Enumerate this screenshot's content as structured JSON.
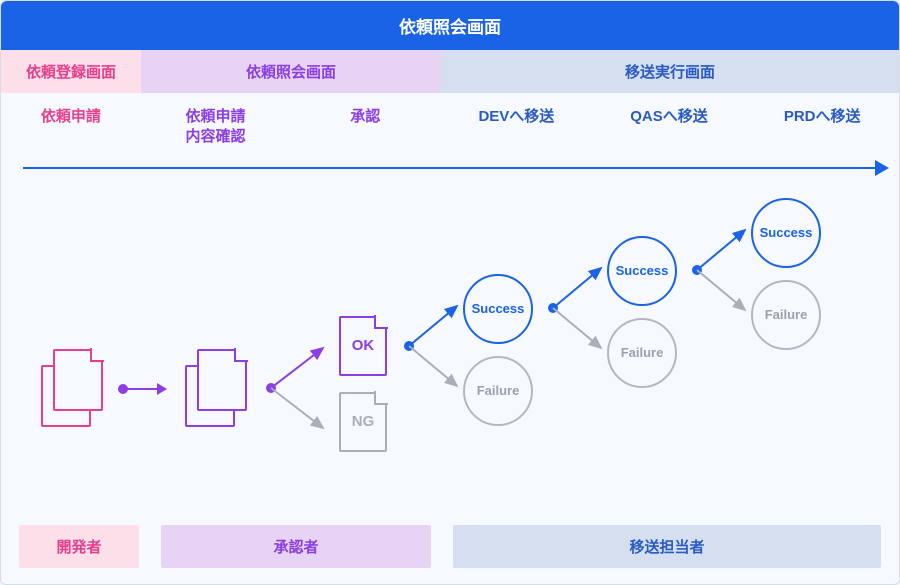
{
  "title": "依頼照会画面",
  "screens": {
    "register": "依頼登録画面",
    "inquiry": "依頼照会画面",
    "transfer": "移送実行画面"
  },
  "steps": {
    "s1": "依頼申請",
    "s2": "依頼申請\n内容確認",
    "s3": "承認",
    "s4": "DEVへ移送",
    "s5": "QASへ移送",
    "s6": "PRDへ移送"
  },
  "approval": {
    "ok": "OK",
    "ng": "NG"
  },
  "status": {
    "success": "Success",
    "failure": "Failure"
  },
  "roles": {
    "developer": "開発者",
    "approver": "承認者",
    "operator": "移送担当者"
  },
  "colors": {
    "pink": "#e83e8c",
    "purple": "#8a3ee4",
    "blue": "#1a62e6",
    "grey": "#a9aeb8"
  }
}
